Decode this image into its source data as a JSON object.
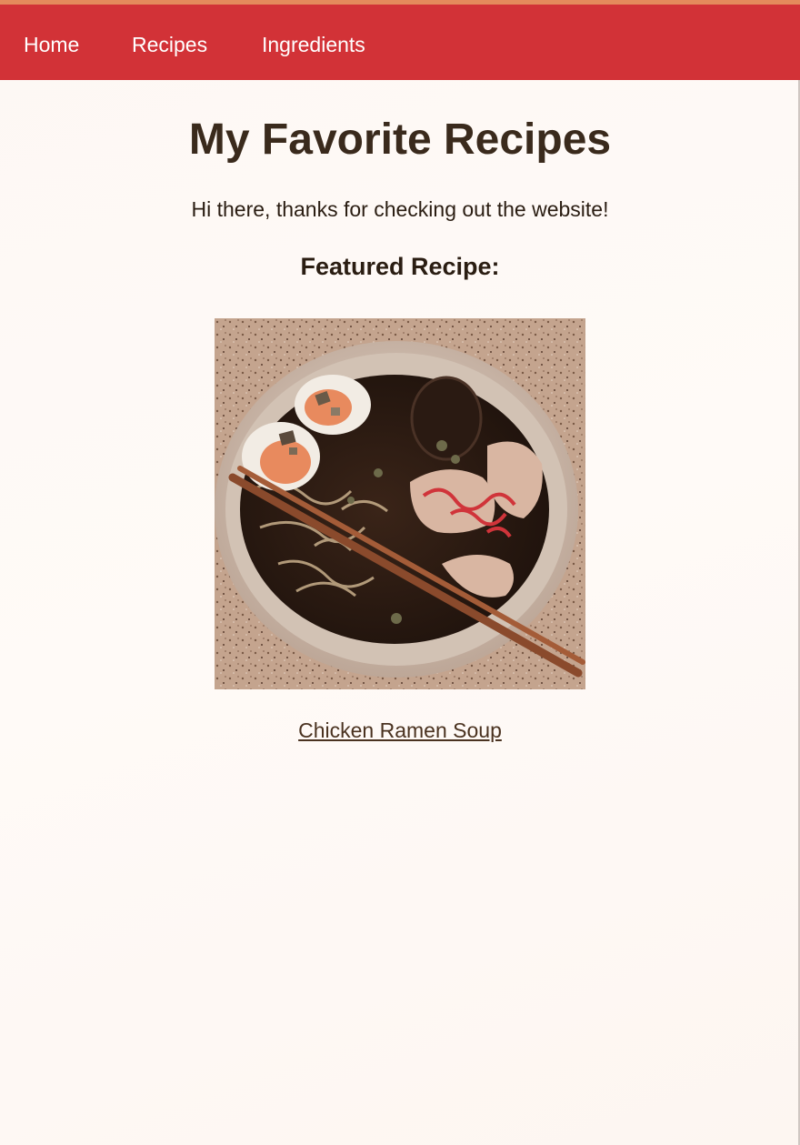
{
  "nav": {
    "items": [
      {
        "label": "Home"
      },
      {
        "label": "Recipes"
      },
      {
        "label": "Ingredients"
      }
    ]
  },
  "main": {
    "title": "My Favorite Recipes",
    "intro": "Hi there, thanks for checking out the website!",
    "featured_heading": "Featured Recipe:",
    "featured_link": "Chicken Ramen Soup"
  },
  "colors": {
    "nav_background": "#d23237",
    "page_background": "#fdf8f4",
    "text": "#3a2a1c"
  }
}
